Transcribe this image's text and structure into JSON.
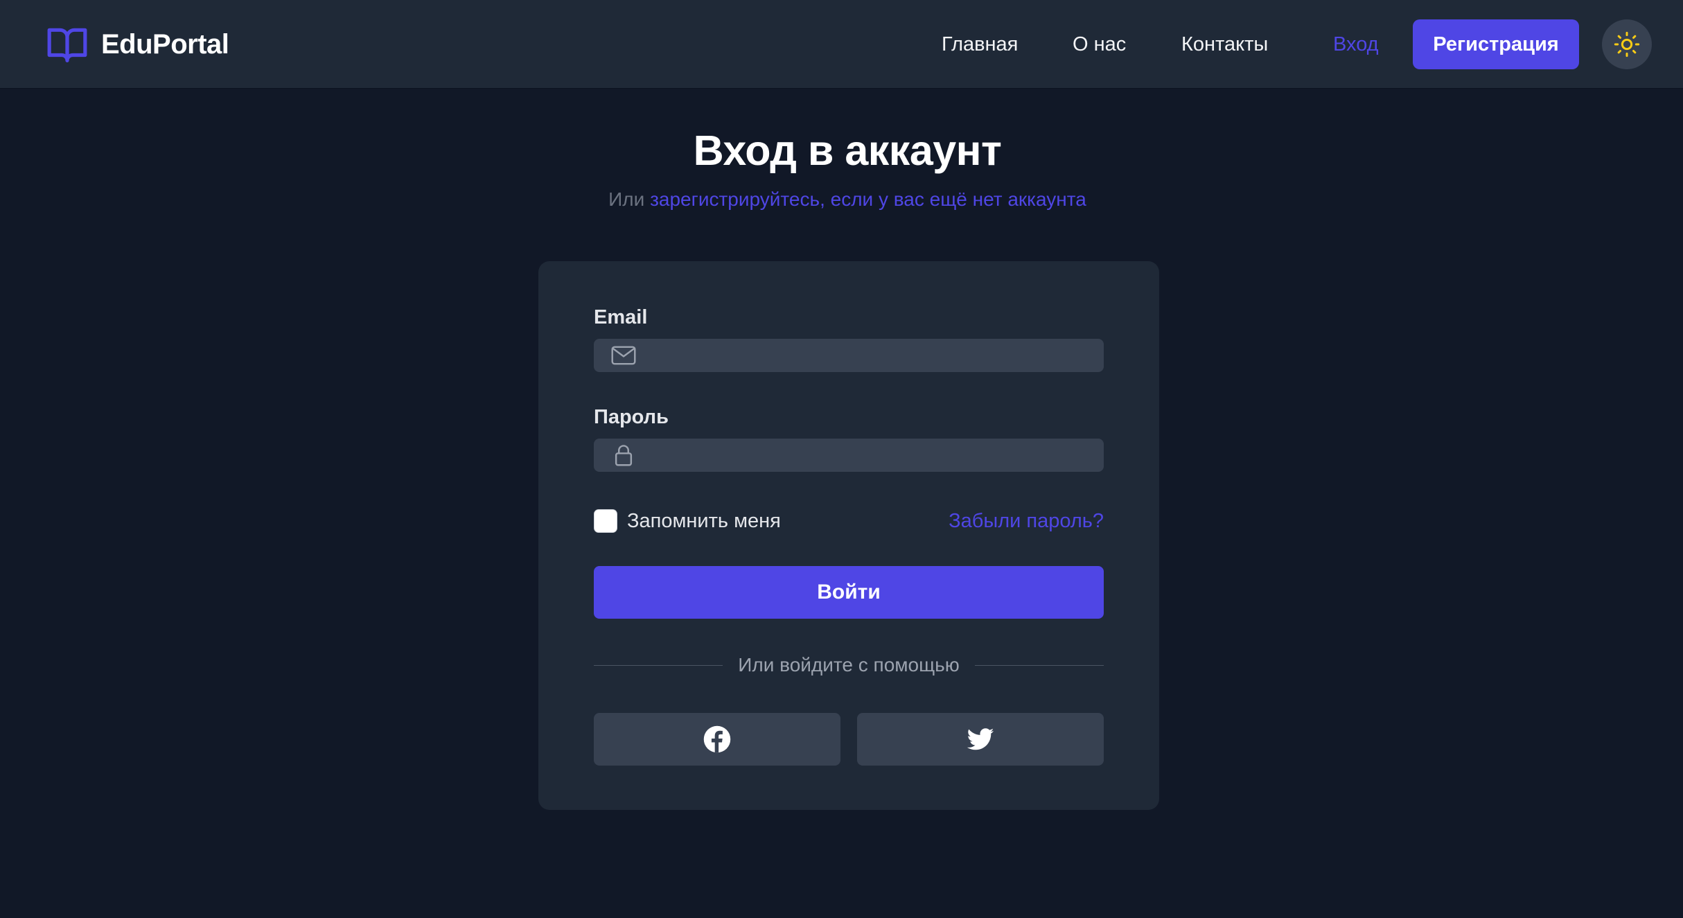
{
  "header": {
    "brand_name": "EduPortal",
    "brand_icon": "open-book-icon",
    "nav": {
      "home": "Главная",
      "about": "О нас",
      "contacts": "Контакты",
      "login": "Вход"
    },
    "register_label": "Регистрация",
    "theme_toggle_icon": "sun-icon"
  },
  "main": {
    "title": "Вход в аккаунт",
    "subtitle_prefix": "Или",
    "subtitle_link": "зарегистрируйтесь, если у вас ещё нет аккаунта"
  },
  "form": {
    "email_label": "Email",
    "email_value": "",
    "email_icon": "envelope-icon",
    "password_label": "Пароль",
    "password_value": "",
    "password_icon": "lock-icon",
    "remember_label": "Запомнить меня",
    "remember_checked": false,
    "forgot_label": "Забыли пароль?",
    "submit_label": "Войти",
    "divider_text": "Или войдите с помощью",
    "social": [
      {
        "name": "facebook",
        "icon": "facebook-icon"
      },
      {
        "name": "twitter",
        "icon": "twitter-icon"
      }
    ]
  },
  "colors": {
    "page_background": "#111827",
    "header_background": "#1f2937",
    "card_background": "#1f2937",
    "input_background": "#374151",
    "accent": "#4f46e5",
    "sun": "#facc15"
  }
}
